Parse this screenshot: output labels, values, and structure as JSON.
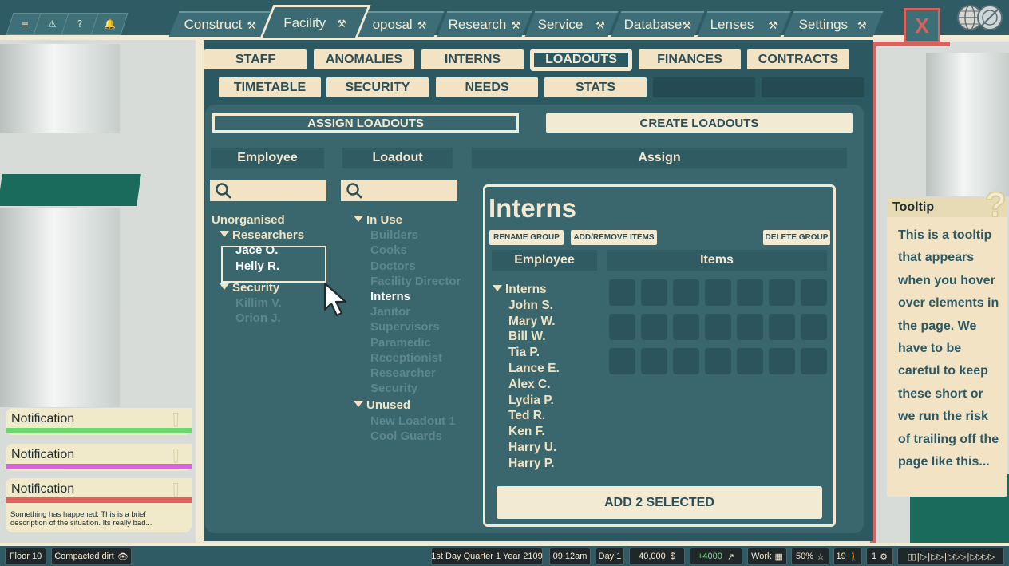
{
  "quick_buttons": [
    {
      "icon": "menu-icon",
      "glyph": "≡"
    },
    {
      "icon": "warning-icon",
      "glyph": "⚠"
    },
    {
      "icon": "help-icon",
      "glyph": "?"
    },
    {
      "icon": "bell-icon",
      "glyph": "🔔"
    }
  ],
  "main_tabs": [
    {
      "label": "Construct",
      "tool": "⚒"
    },
    {
      "label": "Facility",
      "tool": "⚒",
      "active": true
    },
    {
      "label": "oposal",
      "tool": "⚒"
    },
    {
      "label": "Research",
      "tool": "⚒"
    },
    {
      "label": "Service",
      "tool": "⚒"
    },
    {
      "label": "Database",
      "tool": "⚒"
    },
    {
      "label": "Lenses",
      "tool": "⚒"
    },
    {
      "label": "Settings",
      "tool": "⚒"
    }
  ],
  "close_label": "X",
  "sub_tabs_row1": [
    "STAFF",
    "ANOMALIES",
    "INTERNS",
    "LOADOUTS",
    "FINANCES",
    "CONTRACTS"
  ],
  "sub_tabs_row2": [
    "TIMETABLE",
    "SECURITY",
    "NEEDS",
    "STATS"
  ],
  "active_sub_tab": "LOADOUTS",
  "mode": {
    "assign": "ASSIGN LOADOUTS",
    "create": "CREATE LOADOUTS"
  },
  "columns": {
    "employee": "Employee",
    "loadout": "Loadout",
    "assign": "Assign"
  },
  "employee_tree": {
    "root": "Unorganised",
    "groups": [
      {
        "name": "Researchers",
        "members": [
          "Jace O.",
          "Helly R."
        ],
        "selected": true
      },
      {
        "name": "Security",
        "members": [
          "Killim V.",
          "Orion J."
        ],
        "selected": false
      }
    ]
  },
  "loadout_tree": {
    "in_use_label": "In Use",
    "in_use": [
      "Builders",
      "Cooks",
      "Doctors",
      "Facility Director",
      "Interns",
      "Janitor",
      "Supervisors",
      "Paramedic",
      "Receptionist",
      "Researcher",
      "Security"
    ],
    "highlighted": "Interns",
    "unused_label": "Unused",
    "unused": [
      "New Loadout 1",
      "Cool Guards"
    ]
  },
  "group": {
    "title": "Interns",
    "rename": "RENAME GROUP",
    "add_remove": "ADD/REMOVE ITEMS",
    "delete": "DELETE GROUP",
    "col_employee": "Employee",
    "col_items": "Items",
    "list_label": "Interns",
    "members": [
      "John S.",
      "Mary W.",
      "Bill W.",
      "Tia P.",
      "Lance E.",
      "Alex C.",
      "Lydia P.",
      "Ted R.",
      "Ken F.",
      "Harry U.",
      "Harry P."
    ],
    "slot_rows": 3,
    "slot_cols": 7,
    "add_selected": "ADD 2 SELECTED"
  },
  "notifications": [
    {
      "label": "Notification",
      "color": "#6ed66e"
    },
    {
      "label": "Notification",
      "color": "#d866d8"
    },
    {
      "label": "Notification",
      "color": "#e0605a",
      "text": "Something has happened.  This is a brief description of the situation. Its really bad..."
    }
  ],
  "tooltip": {
    "title": "Tooltip",
    "text": "This is a tooltip that appears when you hover over elements in the page. We have to be careful to keep these short or we run the risk of trailing off the page like this..."
  },
  "status_bar": {
    "floor": "Floor 10",
    "terrain": "Compacted dirt",
    "date": "1st Day Quarter 1 Year 2109",
    "time": "09:12am",
    "day": "Day 1",
    "money": "40,000",
    "money_delta": "+4000",
    "activity": "Work",
    "percent": "50%",
    "staff_count": "19",
    "alert_count": "1",
    "speed_controls": "▯▯ | ▷ | ▷▷ | ▷▷▷ | ▷▷▷▷"
  },
  "colors": {
    "panel": "#2c5861",
    "cream": "#f3ead3",
    "accent_red": "#d8635e"
  }
}
